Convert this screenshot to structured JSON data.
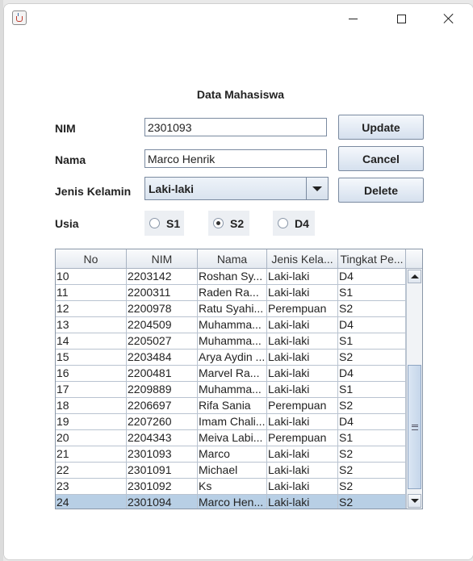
{
  "window": {
    "controls": [
      "minimize",
      "maximize",
      "close"
    ]
  },
  "form": {
    "title": "Data Mahasiswa",
    "nim_label": "NIM",
    "nim_value": "2301093",
    "nama_label": "Nama",
    "nama_value": "Marco Henrik",
    "jk_label": "Jenis Kelamin",
    "jk_value": "Laki-laki",
    "usia_label": "Usia",
    "radio_options": [
      "S1",
      "S2",
      "D4"
    ],
    "radio_selected": "S2"
  },
  "buttons": {
    "update": "Update",
    "cancel": "Cancel",
    "delete": "Delete"
  },
  "table": {
    "columns": [
      "No",
      "NIM",
      "Nama",
      "Jenis Kela...",
      "Tingkat Pe..."
    ],
    "rows": [
      [
        "10",
        "2203142",
        "Roshan Sy...",
        "Laki-laki",
        "D4"
      ],
      [
        "11",
        "2200311",
        "Raden Ra...",
        "Laki-laki",
        "S1"
      ],
      [
        "12",
        "2200978",
        "Ratu Syahi...",
        "Perempuan",
        "S2"
      ],
      [
        "13",
        "2204509",
        "Muhamma...",
        "Laki-laki",
        "D4"
      ],
      [
        "14",
        "2205027",
        "Muhamma...",
        "Laki-laki",
        "S1"
      ],
      [
        "15",
        "2203484",
        "Arya Aydin ...",
        "Laki-laki",
        "S2"
      ],
      [
        "16",
        "2200481",
        "Marvel Ra...",
        "Laki-laki",
        "D4"
      ],
      [
        "17",
        "2209889",
        "Muhamma...",
        "Laki-laki",
        "S1"
      ],
      [
        "18",
        "2206697",
        "Rifa Sania",
        "Perempuan",
        "S2"
      ],
      [
        "19",
        "2207260",
        "Imam Chali...",
        "Laki-laki",
        "D4"
      ],
      [
        "20",
        "2204343",
        "Meiva Labi...",
        "Perempuan",
        "S1"
      ],
      [
        "21",
        "2301093",
        "Marco",
        "Laki-laki",
        "S2"
      ],
      [
        "22",
        "2301091",
        "Michael",
        "Laki-laki",
        "S2"
      ],
      [
        "23",
        "2301092",
        "Ks",
        "Laki-laki",
        "S2"
      ],
      [
        "24",
        "2301094",
        "Marco Hen...",
        "Laki-laki",
        "S2"
      ]
    ],
    "selected_row": 14
  }
}
